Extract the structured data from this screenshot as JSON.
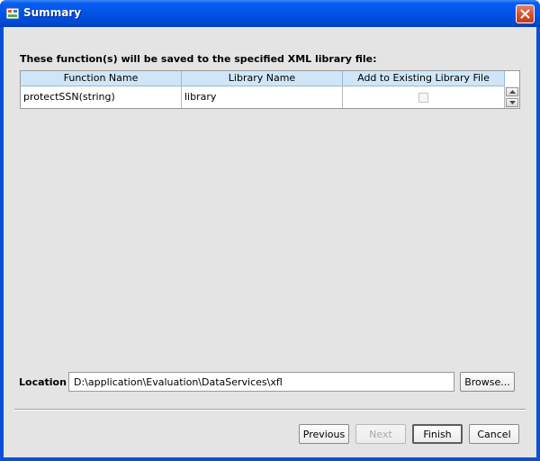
{
  "window": {
    "title": "Summary"
  },
  "heading": "These function(s) will be saved to the specified XML library file:",
  "table": {
    "columns": [
      "Function Name",
      "Library Name",
      "Add to Existing Library File"
    ],
    "rows": [
      {
        "function_name": "protectSSN(string)",
        "library_name": "library",
        "add_existing": false
      }
    ]
  },
  "location": {
    "label": "Location",
    "value": "D:\\application\\Evaluation\\DataServices\\xfl",
    "browse_label": "Browse..."
  },
  "buttons": {
    "previous": "Previous",
    "next": "Next",
    "finish": "Finish",
    "cancel": "Cancel"
  },
  "colors": {
    "titlebar": "#0053e6",
    "header": "#cfe6f8",
    "dialog_bg": "#e4e4e4",
    "close": "#d8532f"
  }
}
